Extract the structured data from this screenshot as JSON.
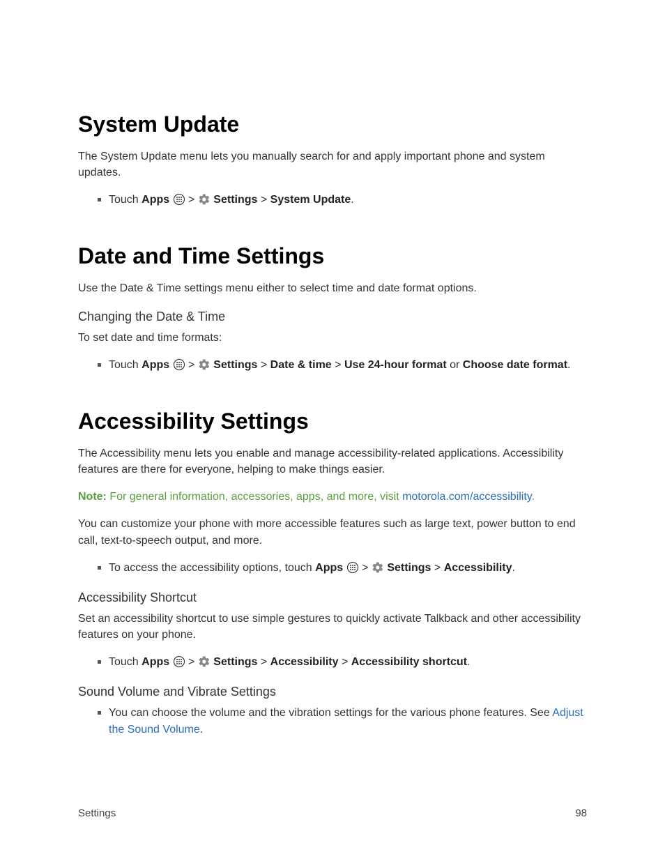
{
  "section1": {
    "heading": "System Update",
    "intro": "The System Update menu lets you manually search for and apply important phone and system updates.",
    "bullet": {
      "prefix": "Touch ",
      "apps": "Apps",
      "settings": "Settings",
      "item": "System Update",
      "suffix": "."
    }
  },
  "section2": {
    "heading": "Date and Time Settings",
    "intro": "Use the Date & Time settings menu either to select time and date format options.",
    "sub1": "Changing the Date & Time",
    "sub1text": "To set date and time formats:",
    "bullet": {
      "prefix": "Touch ",
      "apps": "Apps",
      "settings": "Settings",
      "item1": "Date & time",
      "item2": "Use 24-hour format",
      "or": " or ",
      "item3": "Choose date format",
      "suffix": "."
    }
  },
  "section3": {
    "heading": "Accessibility Settings",
    "intro": "The Accessibility menu lets you enable and manage accessibility-related applications. Accessibility features are there for everyone, helping to make things easier.",
    "note": {
      "label": "Note:",
      "text": " For general information, accessories, apps, and more, visit ",
      "link": "motorola.com/accessibility",
      "suffix": "."
    },
    "p2": "You can customize your phone with more accessible features such as large text, power button to end call, text-to-speech output, and more.",
    "bullet1": {
      "prefix": "To access the accessibility options, touch ",
      "apps": "Apps",
      "settings": "Settings",
      "item": "Accessibility",
      "suffix": "."
    },
    "sub1": "Accessibility Shortcut",
    "sub1text": "Set an accessibility shortcut to use simple gestures to quickly activate Talkback and other accessibility features on your phone.",
    "bullet2": {
      "prefix": "Touch ",
      "apps": "Apps",
      "settings": "Settings",
      "item1": "Accessibility",
      "item2": "Accessibility shortcut",
      "suffix": "."
    },
    "sub2": "Sound Volume and Vibrate Settings",
    "bullet3": {
      "text": "You can choose the volume and the vibration settings for the various phone features. See ",
      "link": "Adjust the Sound Volume",
      "suffix": "."
    }
  },
  "footer": {
    "left": "Settings",
    "right": "98"
  },
  "sep": ">"
}
